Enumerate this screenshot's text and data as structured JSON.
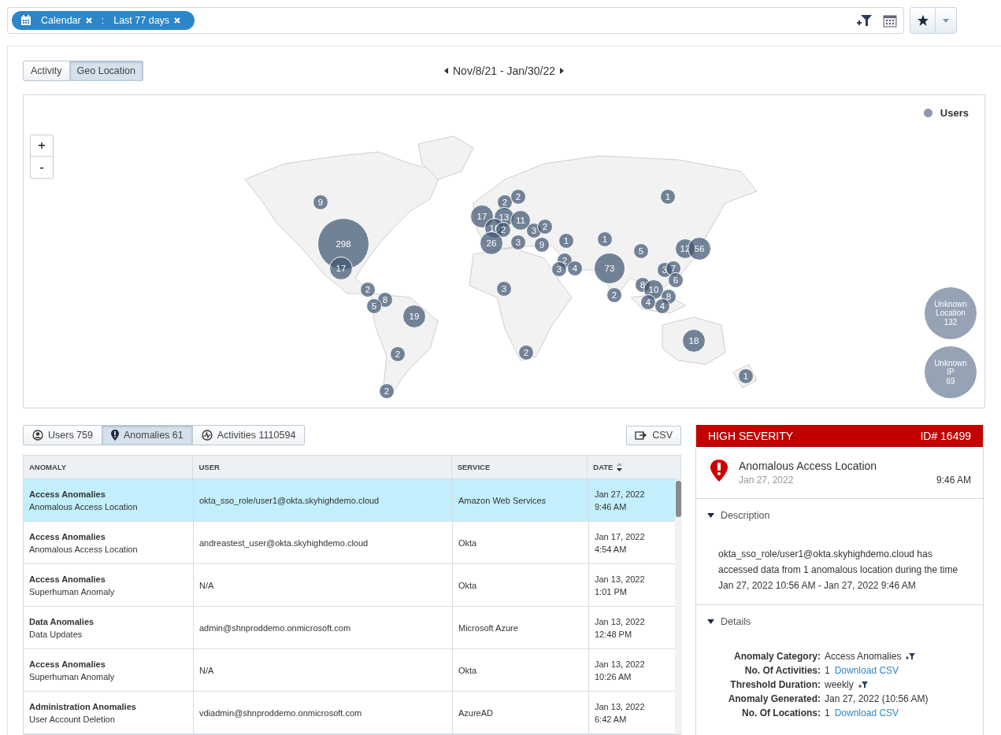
{
  "filter_bar": {
    "chips": [
      {
        "label": "Calendar"
      },
      {
        "label": "Last 77 days"
      }
    ],
    "separator": ":"
  },
  "view_tabs": [
    {
      "label": "Activity",
      "selected": false
    },
    {
      "label": "Geo Location",
      "selected": true
    }
  ],
  "date_range": "Nov/8/21 - Jan/30/22",
  "map": {
    "legend": "Users",
    "zoom_in": "+",
    "zoom_out": "-",
    "clusters": [
      {
        "count": "9"
      },
      {
        "count": "298"
      },
      {
        "count": "17"
      },
      {
        "count": "2"
      },
      {
        "count": "8"
      },
      {
        "count": "5"
      },
      {
        "count": "19"
      },
      {
        "count": "2"
      },
      {
        "count": "2"
      },
      {
        "count": "17"
      },
      {
        "count": "2"
      },
      {
        "count": "2"
      },
      {
        "count": "13"
      },
      {
        "count": "10"
      },
      {
        "count": "2"
      },
      {
        "count": "11"
      },
      {
        "count": "3"
      },
      {
        "count": "2"
      },
      {
        "count": "26"
      },
      {
        "count": "3"
      },
      {
        "count": "9"
      },
      {
        "count": "1"
      },
      {
        "count": "1"
      },
      {
        "count": "2"
      },
      {
        "count": "3"
      },
      {
        "count": "4"
      },
      {
        "count": "73"
      },
      {
        "count": "2"
      },
      {
        "count": "3"
      },
      {
        "count": "2"
      },
      {
        "count": "1"
      },
      {
        "count": "5"
      },
      {
        "count": "12"
      },
      {
        "count": "56"
      },
      {
        "count": "3"
      },
      {
        "count": "7"
      },
      {
        "count": "6"
      },
      {
        "count": "8"
      },
      {
        "count": "10"
      },
      {
        "count": "4"
      },
      {
        "count": "8"
      },
      {
        "count": "4"
      },
      {
        "count": "18"
      },
      {
        "count": "1"
      }
    ],
    "unknown": [
      {
        "label": "Unknown Location",
        "count": "132"
      },
      {
        "label": "Unknown IP",
        "count": "69"
      }
    ]
  },
  "list_tabs": [
    {
      "label": "Users 759",
      "kind": "user",
      "selected": false
    },
    {
      "label": "Anomalies 61",
      "kind": "anomaly",
      "selected": true
    },
    {
      "label": "Activities 1110594",
      "kind": "activity",
      "selected": false
    }
  ],
  "csv_button": "CSV",
  "table": {
    "columns": [
      {
        "label": "ANOMALY",
        "sortable": false
      },
      {
        "label": "USER",
        "sortable": false
      },
      {
        "label": "SERVICE",
        "sortable": false
      },
      {
        "label": "DATE",
        "sortable": true
      }
    ],
    "rows": [
      {
        "category": "Access Anomalies",
        "type": "Anomalous Access Location",
        "user": "okta_sso_role/user1@okta.skyhighdemo.cloud",
        "service": "Amazon Web Services",
        "date": "Jan 27, 2022",
        "time": "9:46 AM",
        "selected": true
      },
      {
        "category": "Access Anomalies",
        "type": "Anomalous Access Location",
        "user": "andreastest_user@okta.skyhighdemo.cloud",
        "service": "Okta",
        "date": "Jan 17, 2022",
        "time": "4:54 AM",
        "selected": false
      },
      {
        "category": "Access Anomalies",
        "type": "Superhuman Anomaly",
        "user": "N/A",
        "service": "Okta",
        "date": "Jan 13, 2022",
        "time": "1:01 PM",
        "selected": false
      },
      {
        "category": "Data Anomalies",
        "type": "Data Updates",
        "user": "admin@shnproddemo.onmicrosoft.com",
        "service": "Microsoft Azure",
        "date": "Jan 13, 2022",
        "time": "12:48 PM",
        "selected": false
      },
      {
        "category": "Access Anomalies",
        "type": "Superhuman Anomaly",
        "user": "N/A",
        "service": "Okta",
        "date": "Jan 13, 2022",
        "time": "10:26 AM",
        "selected": false
      },
      {
        "category": "Administration Anomalies",
        "type": "User Account Deletion",
        "user": "vdiadmin@shnproddemo.onmicrosoft.com",
        "service": "AzureAD",
        "date": "Jan 13, 2022",
        "time": "6:42 AM",
        "selected": false
      }
    ]
  },
  "detail": {
    "severity": "HIGH SEVERITY",
    "id": "ID# 16499",
    "title": "Anomalous Access Location",
    "date": "Jan 27, 2022",
    "time": "9:46 AM",
    "description": {
      "title": "Description",
      "expanded": true,
      "text": "okta_sso_role/user1@okta.skyhighdemo.cloud has accessed data from 1 anomalous location during the time Jan 27, 2022 10:56 AM - Jan 27, 2022 9:46 AM"
    },
    "details": {
      "title": "Details",
      "expanded": true,
      "fields": [
        {
          "label": "Anomaly Category:",
          "value": "Access Anomalies",
          "filter": true
        },
        {
          "label": "No. Of Activities:",
          "value": "1",
          "link": "Download CSV",
          "filter": false
        },
        {
          "label": "Threshold Duration:",
          "value": "weekly",
          "filter": true
        },
        {
          "label": "Anomaly Generated:",
          "value": "Jan 27, 2022 (10:56 AM)",
          "filter": false
        },
        {
          "label": "No. Of Locations:",
          "value": "1",
          "link": "Download CSV",
          "filter": false
        }
      ]
    }
  }
}
